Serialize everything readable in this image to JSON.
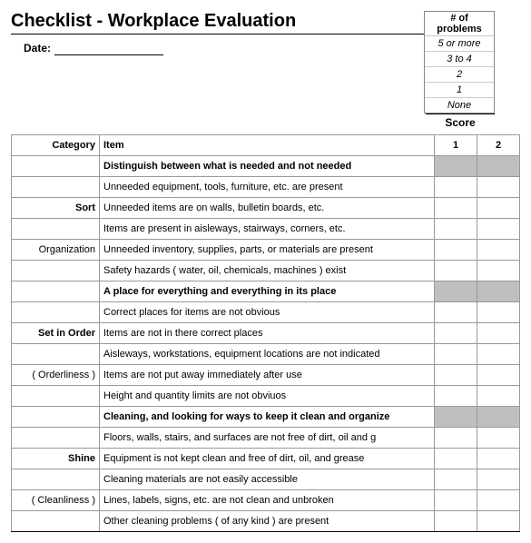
{
  "title": "Checklist - Workplace Evaluation",
  "date_label": "Date:",
  "problems_box": {
    "header": "# of problems",
    "levels": [
      "5 or more",
      "3 to 4",
      "2",
      "1",
      "None"
    ]
  },
  "score_label": "Score",
  "table_headers": {
    "category": "Category",
    "item": "Item",
    "col1": "1",
    "col2": "2"
  },
  "sections": [
    {
      "cat_labels": [
        "",
        "",
        "Sort",
        "",
        "Organization",
        ""
      ],
      "header_item": "Distinguish between what is needed and not needed",
      "items": [
        "Unneeded equipment, tools, furniture, etc. are present",
        "Unneeded items are on walls, bulletin boards, etc.",
        "Items are present in aisleways, stairways, corners, etc.",
        "Unneeded inventory, supplies, parts, or materials are present",
        "Safety hazards ( water, oil, chemicals, machines ) exist"
      ]
    },
    {
      "cat_labels": [
        "",
        "",
        "Set in Order",
        "",
        "( Orderliness )",
        ""
      ],
      "header_item": "A place for everything and everything in its place",
      "items": [
        "Correct places for items are not obvious",
        "Items are not in there correct places",
        "Aisleways, workstations, equipment locations are not indicated",
        "Items are not put away immediately after use",
        "Height and quantity limits are not obviuos"
      ]
    },
    {
      "cat_labels": [
        "",
        "",
        "Shine",
        "",
        "( Cleanliness )",
        ""
      ],
      "header_item": "Cleaning, and looking for ways to keep it clean and organize",
      "items": [
        "Floors, walls, stairs, and surfaces are not free of dirt, oil and g",
        "Equipment is not kept clean and free of dirt, oil, and grease",
        "Cleaning materials are not easily accessible",
        "Lines, labels, signs, etc. are not clean and unbroken",
        "Other cleaning problems ( of any kind ) are present"
      ]
    }
  ]
}
